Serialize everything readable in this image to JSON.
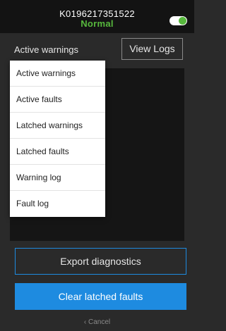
{
  "header": {
    "device_id": "K0196217351522",
    "status": "Normal"
  },
  "filter": {
    "selected": "Active warnings",
    "options": [
      "Active warnings",
      "Active faults",
      "Latched warnings",
      "Latched faults",
      "Warning log",
      "Fault log"
    ]
  },
  "actions": {
    "view_logs": "View Logs",
    "export": "Export diagnostics",
    "clear": "Clear latched faults",
    "cancel": "‹ Cancel"
  },
  "colors": {
    "accent": "#1e8be0",
    "status_ok": "#57b83d",
    "background": "#2a2a2a"
  }
}
